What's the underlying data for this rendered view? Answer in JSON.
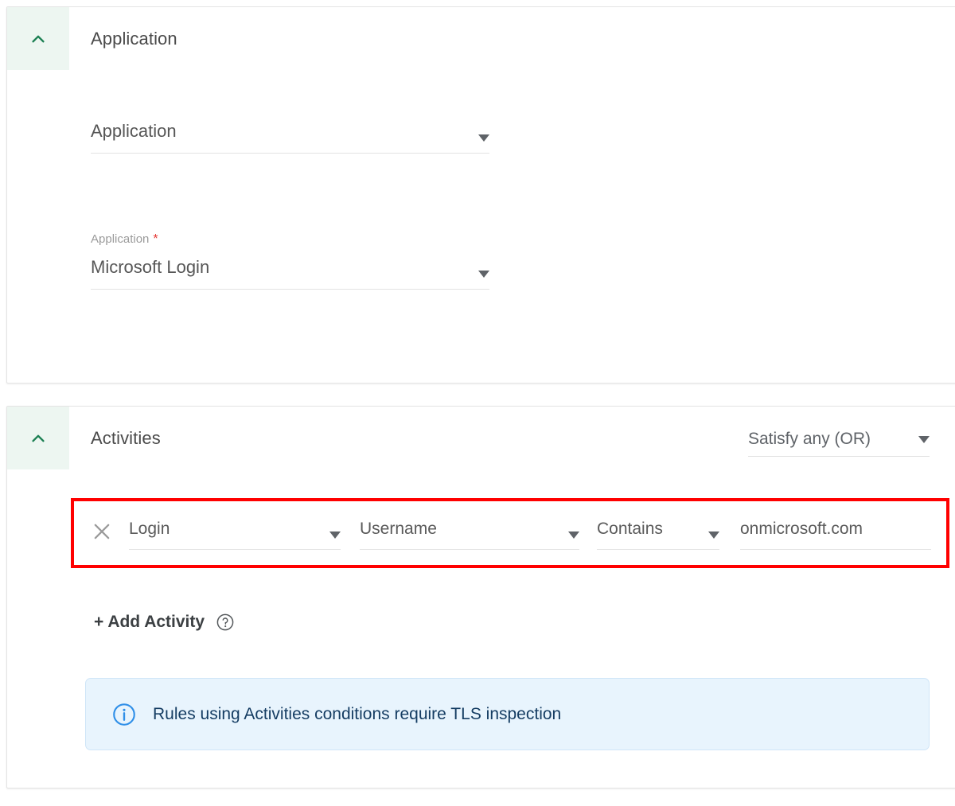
{
  "sections": [
    {
      "id": "application",
      "title": "Application",
      "collapse_icon": "chevron-up-icon",
      "expanded": true,
      "fields": [
        {
          "id": "application-scope",
          "label": "",
          "required": false,
          "value": "Application",
          "caret_icon": "chevron-down-icon"
        },
        {
          "id": "application-name",
          "label": "Application",
          "required": true,
          "required_marker": "*",
          "value": "Microsoft Login",
          "caret_icon": "chevron-down-icon"
        }
      ]
    },
    {
      "id": "activities",
      "title": "Activities",
      "collapse_icon": "chevron-up-icon",
      "expanded": true,
      "match_mode": {
        "value": "Satisfy any (OR)",
        "caret_icon": "chevron-down-icon"
      },
      "activity_row": {
        "remove_icon": "close-x-icon",
        "highlighted": true,
        "highlight_color": "#ff0000",
        "activity": {
          "value": "Login",
          "caret_icon": "chevron-down-icon"
        },
        "attribute": {
          "value": "Username",
          "caret_icon": "chevron-down-icon"
        },
        "operator": {
          "value": "Contains",
          "caret_icon": "chevron-down-icon"
        },
        "criteria": {
          "value": "onmicrosoft.com",
          "placeholder": "Value"
        }
      },
      "add_activity": {
        "label": "+ Add Activity",
        "help_icon": "question-circle-icon"
      },
      "info_banner": {
        "icon": "info-circle-icon",
        "text": "Rules using Activities conditions require TLS inspection",
        "background": "#e8f4fd",
        "border": "#cfe5f8",
        "text_color": "#153d63",
        "icon_color": "#2f8fe8"
      }
    }
  ],
  "theme": {
    "accent_green": "#1b7f52",
    "accent_green_bg": "#edf6f1",
    "required_red": "#e53935",
    "highlight_red": "#ff0000"
  }
}
